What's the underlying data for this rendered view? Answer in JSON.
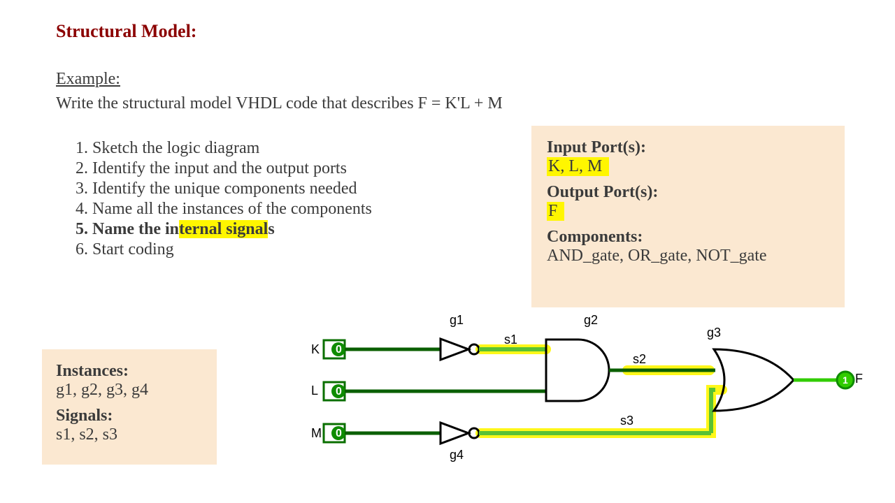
{
  "title": "Structural Model:",
  "example_heading": "Example:",
  "prompt": "Write the structural model VHDL code that describes F = K'L + M",
  "steps": {
    "items": [
      "Sketch the logic diagram",
      "Identify the input and the output ports",
      "Identify the unique components needed",
      "Name all the instances of the components",
      "Name the internal signals",
      "Start coding"
    ],
    "bold_index": 4,
    "highlight_text_inside": "ternal signal"
  },
  "right_box": {
    "input_label": "Input Port(s):",
    "input_value": "K, L, M",
    "output_label": "Output Port(s):",
    "output_value": "F",
    "components_label": "Components:",
    "components_value": "AND_gate, OR_gate, NOT_gate"
  },
  "left_box": {
    "instances_label": "Instances:",
    "instances_value": "g1, g2, g3, g4",
    "signals_label": "Signals:",
    "signals_value": "s1, s2, s3"
  },
  "diagram": {
    "port_k": "K",
    "port_l": "L",
    "port_m": "M",
    "port_f": "F",
    "gate_g1": "g1",
    "gate_g2": "g2",
    "gate_g3": "g3",
    "gate_g4": "g4",
    "sig_s1": "s1",
    "sig_s2": "s2",
    "sig_s3": "s3",
    "zero": "0",
    "one": "1"
  }
}
